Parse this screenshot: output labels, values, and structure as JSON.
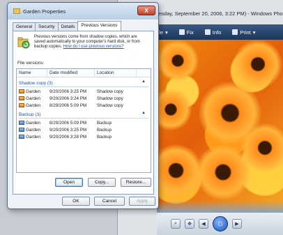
{
  "gallery": {
    "title": "esday, September 20, 2006, 3:22 PM) - Windows Photo Gal",
    "toolbar": {
      "gallery": "allery",
      "file": "File",
      "fix": "Fix",
      "info": "Info",
      "print": "Print"
    }
  },
  "dialog": {
    "title": "Garden Properties",
    "close_label": "X",
    "tabs": [
      "General",
      "Security",
      "Details",
      "Previous Versions"
    ],
    "active_tab": "Previous Versions",
    "info_text": "Previous versions come from shadow copies, which are saved automatically to your computer's hard disk, or from backup copies.",
    "info_link": "How do I use previous versions?",
    "file_versions_label": "File versions:",
    "columns": {
      "name": "Name",
      "date": "Date modified",
      "location": "Location"
    },
    "groups": [
      {
        "label": "Shadow copy (3)",
        "type": "shadow",
        "rows": [
          {
            "name": "Garden",
            "date": "9/20/2006 3:25 PM",
            "location": "Shadow copy"
          },
          {
            "name": "Garden",
            "date": "9/20/2006 3:24 PM",
            "location": "Shadow copy"
          },
          {
            "name": "Garden",
            "date": "8/29/2006 5:09 PM",
            "location": "Shadow copy"
          }
        ]
      },
      {
        "label": "Backup (3)",
        "type": "backup",
        "rows": [
          {
            "name": "Garden",
            "date": "8/29/2006 5:09 PM",
            "location": "Backup"
          },
          {
            "name": "Garden",
            "date": "9/20/2006 3:25 PM",
            "location": "Backup"
          },
          {
            "name": "Garden",
            "date": "9/20/2006 3:28 PM",
            "location": "Backup"
          }
        ]
      }
    ],
    "buttons": {
      "open": "Open",
      "copy": "Copy...",
      "restore": "Restore..."
    },
    "footer": {
      "ok": "OK",
      "cancel": "Cancel",
      "apply": "Apply"
    }
  }
}
